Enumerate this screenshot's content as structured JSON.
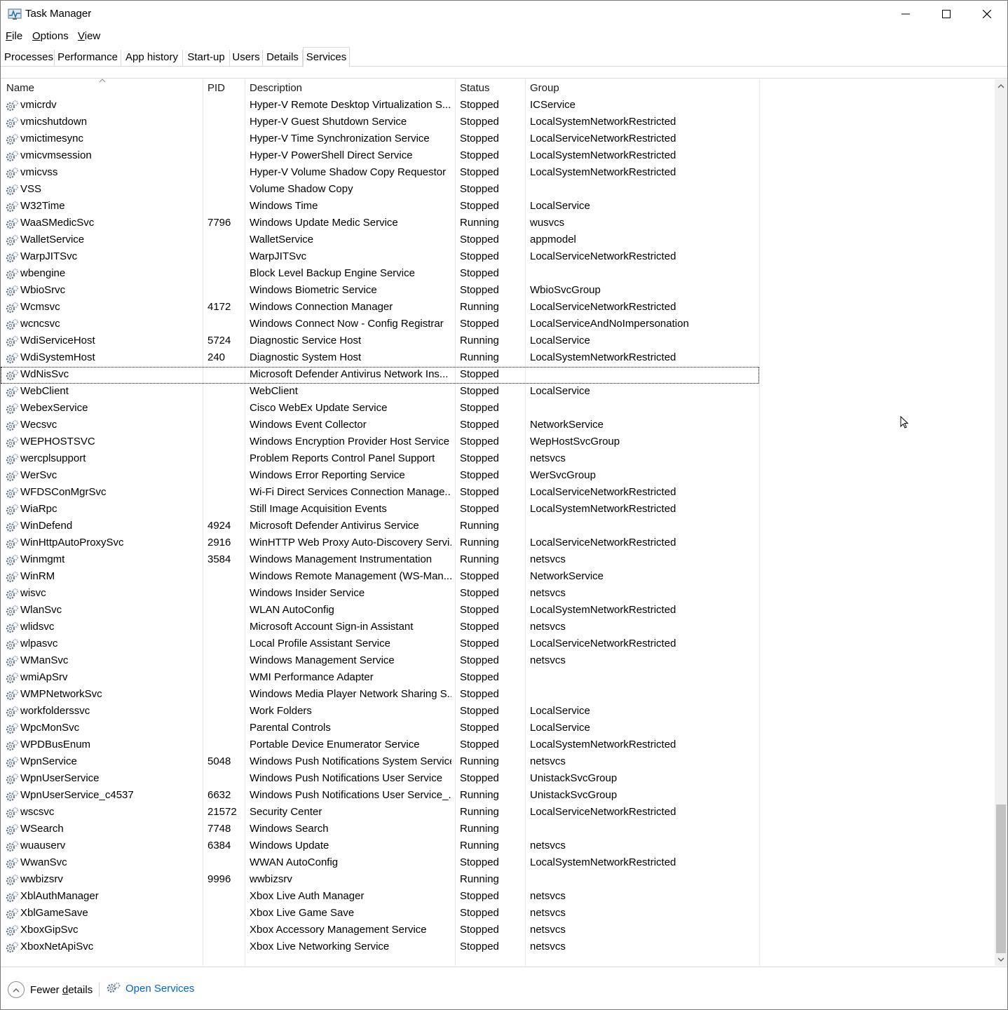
{
  "window": {
    "title": "Task Manager",
    "controls": {
      "minimize": "minimize-icon",
      "maximize": "maximize-icon",
      "close": "close-icon"
    }
  },
  "menu": [
    {
      "prefix": "",
      "underline": "F",
      "rest": "ile"
    },
    {
      "prefix": "",
      "underline": "O",
      "rest": "ptions"
    },
    {
      "prefix": "",
      "underline": "V",
      "rest": "iew"
    }
  ],
  "tabs": [
    "Processes",
    "Performance",
    "App history",
    "Start-up",
    "Users",
    "Details",
    "Services"
  ],
  "active_tab": "Services",
  "columns": {
    "name": "Name",
    "pid": "PID",
    "description": "Description",
    "status": "Status",
    "group": "Group"
  },
  "selected_row": "WdNisSvc",
  "rows": [
    {
      "name": "vmicrdv",
      "pid": "",
      "description": "Hyper-V Remote Desktop Virtualization S...",
      "status": "Stopped",
      "group": "ICService"
    },
    {
      "name": "vmicshutdown",
      "pid": "",
      "description": "Hyper-V Guest Shutdown Service",
      "status": "Stopped",
      "group": "LocalSystemNetworkRestricted"
    },
    {
      "name": "vmictimesync",
      "pid": "",
      "description": "Hyper-V Time Synchronization Service",
      "status": "Stopped",
      "group": "LocalServiceNetworkRestricted"
    },
    {
      "name": "vmicvmsession",
      "pid": "",
      "description": "Hyper-V PowerShell Direct Service",
      "status": "Stopped",
      "group": "LocalSystemNetworkRestricted"
    },
    {
      "name": "vmicvss",
      "pid": "",
      "description": "Hyper-V Volume Shadow Copy Requestor",
      "status": "Stopped",
      "group": "LocalSystemNetworkRestricted"
    },
    {
      "name": "VSS",
      "pid": "",
      "description": "Volume Shadow Copy",
      "status": "Stopped",
      "group": ""
    },
    {
      "name": "W32Time",
      "pid": "",
      "description": "Windows Time",
      "status": "Stopped",
      "group": "LocalService"
    },
    {
      "name": "WaaSMedicSvc",
      "pid": "7796",
      "description": "Windows Update Medic Service",
      "status": "Running",
      "group": "wusvcs"
    },
    {
      "name": "WalletService",
      "pid": "",
      "description": "WalletService",
      "status": "Stopped",
      "group": "appmodel"
    },
    {
      "name": "WarpJITSvc",
      "pid": "",
      "description": "WarpJITSvc",
      "status": "Stopped",
      "group": "LocalServiceNetworkRestricted"
    },
    {
      "name": "wbengine",
      "pid": "",
      "description": "Block Level Backup Engine Service",
      "status": "Stopped",
      "group": ""
    },
    {
      "name": "WbioSrvc",
      "pid": "",
      "description": "Windows Biometric Service",
      "status": "Stopped",
      "group": "WbioSvcGroup"
    },
    {
      "name": "Wcmsvc",
      "pid": "4172",
      "description": "Windows Connection Manager",
      "status": "Running",
      "group": "LocalServiceNetworkRestricted"
    },
    {
      "name": "wcncsvc",
      "pid": "",
      "description": "Windows Connect Now - Config Registrar",
      "status": "Stopped",
      "group": "LocalServiceAndNoImpersonation"
    },
    {
      "name": "WdiServiceHost",
      "pid": "5724",
      "description": "Diagnostic Service Host",
      "status": "Running",
      "group": "LocalService"
    },
    {
      "name": "WdiSystemHost",
      "pid": "240",
      "description": "Diagnostic System Host",
      "status": "Running",
      "group": "LocalSystemNetworkRestricted"
    },
    {
      "name": "WdNisSvc",
      "pid": "",
      "description": "Microsoft Defender Antivirus Network Ins...",
      "status": "Stopped",
      "group": ""
    },
    {
      "name": "WebClient",
      "pid": "",
      "description": "WebClient",
      "status": "Stopped",
      "group": "LocalService"
    },
    {
      "name": "WebexService",
      "pid": "",
      "description": "Cisco WebEx Update Service",
      "status": "Stopped",
      "group": ""
    },
    {
      "name": "Wecsvc",
      "pid": "",
      "description": "Windows Event Collector",
      "status": "Stopped",
      "group": "NetworkService"
    },
    {
      "name": "WEPHOSTSVC",
      "pid": "",
      "description": "Windows Encryption Provider Host Service",
      "status": "Stopped",
      "group": "WepHostSvcGroup"
    },
    {
      "name": "wercplsupport",
      "pid": "",
      "description": "Problem Reports Control Panel Support",
      "status": "Stopped",
      "group": "netsvcs"
    },
    {
      "name": "WerSvc",
      "pid": "",
      "description": "Windows Error Reporting Service",
      "status": "Stopped",
      "group": "WerSvcGroup"
    },
    {
      "name": "WFDSConMgrSvc",
      "pid": "",
      "description": "Wi-Fi Direct Services Connection Manage...",
      "status": "Stopped",
      "group": "LocalServiceNetworkRestricted"
    },
    {
      "name": "WiaRpc",
      "pid": "",
      "description": "Still Image Acquisition Events",
      "status": "Stopped",
      "group": "LocalSystemNetworkRestricted"
    },
    {
      "name": "WinDefend",
      "pid": "4924",
      "description": "Microsoft Defender Antivirus Service",
      "status": "Running",
      "group": ""
    },
    {
      "name": "WinHttpAutoProxySvc",
      "pid": "2916",
      "description": "WinHTTP Web Proxy Auto-Discovery Servi...",
      "status": "Running",
      "group": "LocalServiceNetworkRestricted"
    },
    {
      "name": "Winmgmt",
      "pid": "3584",
      "description": "Windows Management Instrumentation",
      "status": "Running",
      "group": "netsvcs"
    },
    {
      "name": "WinRM",
      "pid": "",
      "description": "Windows Remote Management (WS-Man...",
      "status": "Stopped",
      "group": "NetworkService"
    },
    {
      "name": "wisvc",
      "pid": "",
      "description": "Windows Insider Service",
      "status": "Stopped",
      "group": "netsvcs"
    },
    {
      "name": "WlanSvc",
      "pid": "",
      "description": "WLAN AutoConfig",
      "status": "Stopped",
      "group": "LocalSystemNetworkRestricted"
    },
    {
      "name": "wlidsvc",
      "pid": "",
      "description": "Microsoft Account Sign-in Assistant",
      "status": "Stopped",
      "group": "netsvcs"
    },
    {
      "name": "wlpasvc",
      "pid": "",
      "description": "Local Profile Assistant Service",
      "status": "Stopped",
      "group": "LocalServiceNetworkRestricted"
    },
    {
      "name": "WManSvc",
      "pid": "",
      "description": "Windows Management Service",
      "status": "Stopped",
      "group": "netsvcs"
    },
    {
      "name": "wmiApSrv",
      "pid": "",
      "description": "WMI Performance Adapter",
      "status": "Stopped",
      "group": ""
    },
    {
      "name": "WMPNetworkSvc",
      "pid": "",
      "description": "Windows Media Player Network Sharing S...",
      "status": "Stopped",
      "group": ""
    },
    {
      "name": "workfolderssvc",
      "pid": "",
      "description": "Work Folders",
      "status": "Stopped",
      "group": "LocalService"
    },
    {
      "name": "WpcMonSvc",
      "pid": "",
      "description": "Parental Controls",
      "status": "Stopped",
      "group": "LocalService"
    },
    {
      "name": "WPDBusEnum",
      "pid": "",
      "description": "Portable Device Enumerator Service",
      "status": "Stopped",
      "group": "LocalSystemNetworkRestricted"
    },
    {
      "name": "WpnService",
      "pid": "5048",
      "description": "Windows Push Notifications System Service",
      "status": "Running",
      "group": "netsvcs"
    },
    {
      "name": "WpnUserService",
      "pid": "",
      "description": "Windows Push Notifications User Service",
      "status": "Stopped",
      "group": "UnistackSvcGroup"
    },
    {
      "name": "WpnUserService_c4537",
      "pid": "6632",
      "description": "Windows Push Notifications User Service_...",
      "status": "Running",
      "group": "UnistackSvcGroup"
    },
    {
      "name": "wscsvc",
      "pid": "21572",
      "description": "Security Center",
      "status": "Running",
      "group": "LocalServiceNetworkRestricted"
    },
    {
      "name": "WSearch",
      "pid": "7748",
      "description": "Windows Search",
      "status": "Running",
      "group": ""
    },
    {
      "name": "wuauserv",
      "pid": "6384",
      "description": "Windows Update",
      "status": "Running",
      "group": "netsvcs"
    },
    {
      "name": "WwanSvc",
      "pid": "",
      "description": "WWAN AutoConfig",
      "status": "Stopped",
      "group": "LocalSystemNetworkRestricted"
    },
    {
      "name": "wwbizsrv",
      "pid": "9996",
      "description": "wwbizsrv",
      "status": "Running",
      "group": ""
    },
    {
      "name": "XblAuthManager",
      "pid": "",
      "description": "Xbox Live Auth Manager",
      "status": "Stopped",
      "group": "netsvcs"
    },
    {
      "name": "XblGameSave",
      "pid": "",
      "description": "Xbox Live Game Save",
      "status": "Stopped",
      "group": "netsvcs"
    },
    {
      "name": "XboxGipSvc",
      "pid": "",
      "description": "Xbox Accessory Management Service",
      "status": "Stopped",
      "group": "netsvcs"
    },
    {
      "name": "XboxNetApiSvc",
      "pid": "",
      "description": "Xbox Live Networking Service",
      "status": "Stopped",
      "group": "netsvcs"
    }
  ],
  "footer": {
    "fewer_prefix": "Fewer ",
    "fewer_underline": "d",
    "fewer_rest": "etails",
    "open_services": "Open Services"
  },
  "icons": {
    "row": "service-gear-icon",
    "app": "task-manager-icon"
  }
}
